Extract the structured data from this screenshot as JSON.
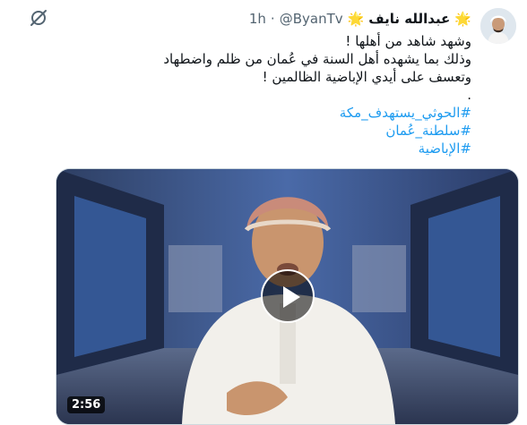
{
  "header": {
    "display_name": "عبدالله نايف",
    "handle": "@ByanTv",
    "separator": "·",
    "timestamp": "1h",
    "star_left": "🌟",
    "star_right": "🌟"
  },
  "body": {
    "lines": [
      "وشهد شاهد من أهلها !",
      "وذلك بما يشهده أهل السنة في عُمان من ظلم واضطهاد",
      "وتعسف على أيدي الإباضية الظالمين !",
      "."
    ],
    "hashtags": [
      "#الحوثي_يستهدف_مكة",
      "#سلطنة_عُمان",
      "#الإباضية"
    ]
  },
  "media": {
    "duration": "2:56"
  },
  "icons": {
    "grok": "grok-icon",
    "play": "play-icon",
    "star": "star-emoji-icon"
  }
}
